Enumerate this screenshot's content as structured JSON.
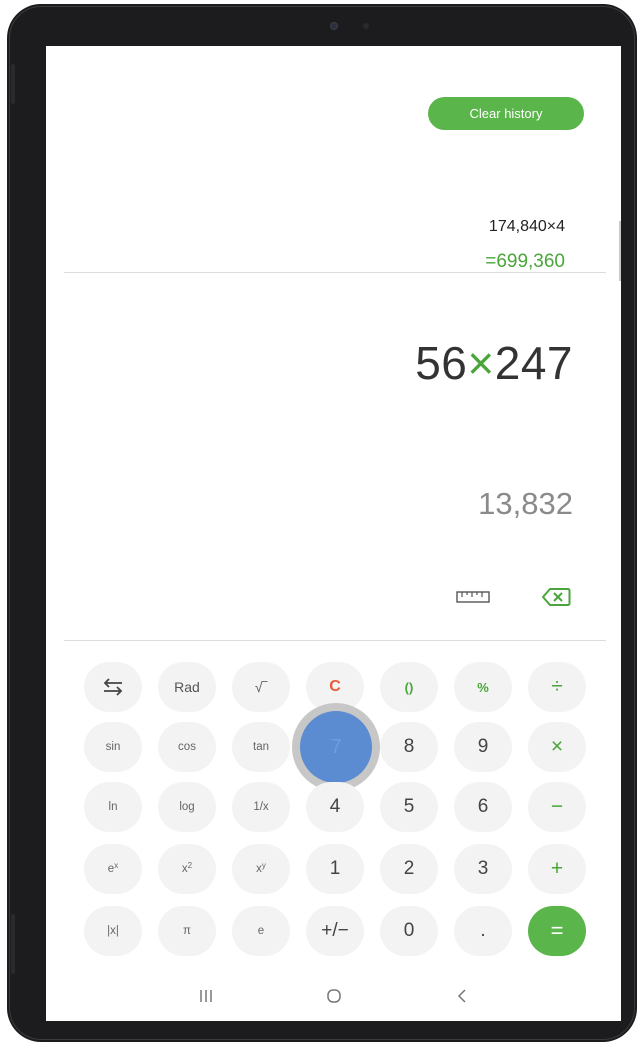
{
  "history": {
    "clear_label": "Clear history",
    "expression": "174,840×4",
    "result": "=699,360"
  },
  "display": {
    "operand1": "56",
    "operator": "×",
    "operand2": "247",
    "preview": "13,832"
  },
  "toolbar": {
    "ruler_icon": "ruler-icon",
    "backspace_icon": "backspace-icon"
  },
  "keys": {
    "swap": "⇆",
    "rad": "Rad",
    "sqrt": "√‾",
    "clear": "C",
    "parens": "()",
    "percent": "%",
    "divide": "÷",
    "sin": "sin",
    "cos": "cos",
    "tan": "tan",
    "seven": "7",
    "eight": "8",
    "nine": "9",
    "multiply": "×",
    "ln": "ln",
    "log": "log",
    "reciprocal": "1/x",
    "four": "4",
    "five": "5",
    "six": "6",
    "minus": "−",
    "exp_base": "e",
    "exp_power": "x",
    "square_base": "x",
    "square_power": "2",
    "power_base": "x",
    "power_power": "y",
    "one": "1",
    "two": "2",
    "three": "3",
    "plus": "+",
    "abs": "|x|",
    "pi": "π",
    "e": "e",
    "negate": "+/−",
    "zero": "0",
    "decimal": ".",
    "equals": "="
  },
  "pressed_key": "7",
  "colors": {
    "accent_green": "#5ab54a",
    "operator_green": "#4aa53a",
    "clear_red": "#e85c3b",
    "pressed_blue": "#5b8bd0"
  },
  "nav": {
    "recents_icon": "recents-icon",
    "home_icon": "home-icon",
    "back_icon": "back-icon"
  }
}
